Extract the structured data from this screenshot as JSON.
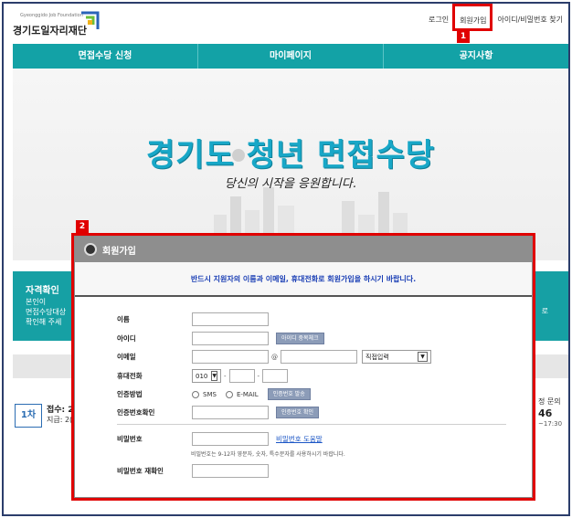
{
  "header": {
    "logo_sub": "Gyeonggido Job Foundation",
    "logo_main": "경기도일자리재단",
    "links": {
      "login": "로그인",
      "signup": "회원가입",
      "find": "아이디/비밀번호 찾기"
    }
  },
  "annotations": {
    "one": "1",
    "two": "2"
  },
  "nav": {
    "items": [
      "면접수당 신청",
      "마이페이지",
      "공지사항"
    ]
  },
  "banner": {
    "title": "경기도 청년 면접수당",
    "subtitle": "당신의 시작을 응원합니다."
  },
  "background": {
    "info_title": "자격확인",
    "info_line1": "본인이",
    "info_line2": "면접수당대상",
    "info_line3": "확인해 주세",
    "info_right": "로",
    "step": "1차",
    "step_a": "접수: 2(",
    "step_b": "지급: 2(",
    "right1": "정 문의",
    "right2": "46",
    "right3": "~17:30"
  },
  "modal": {
    "title": "회원가입",
    "notice": "반드시 지원자의 이름과 이메일, 휴대전화로 회원가입을 하시기 바랍니다.",
    "labels": {
      "name": "이름",
      "id": "아이디",
      "email": "이메일",
      "phone": "휴대전화",
      "auth_method": "인증방법",
      "auth_code": "인증번호확인",
      "password": "비밀번호",
      "password_confirm": "비밀번호 재확인"
    },
    "buttons": {
      "id_check": "아이디 중복체크",
      "send_code": "인증번호 발송",
      "verify_code": "인증번호 확인"
    },
    "email_at": "@",
    "email_domain_select": "직접입력",
    "phone_prefix": "010",
    "phone_dash": "-",
    "radio_sms": "SMS",
    "radio_email": "E-MAIL",
    "password_help": "비밀번호 도움말",
    "password_hint": "비밀번호는 9-12자 영문자, 숫자, 특수문자를 사용하시기 바랍니다."
  },
  "colors": {
    "nav": "#13a2a6",
    "highlight": "#e00000",
    "notice": "#1b3fb5",
    "button": "#8c9cb8"
  }
}
